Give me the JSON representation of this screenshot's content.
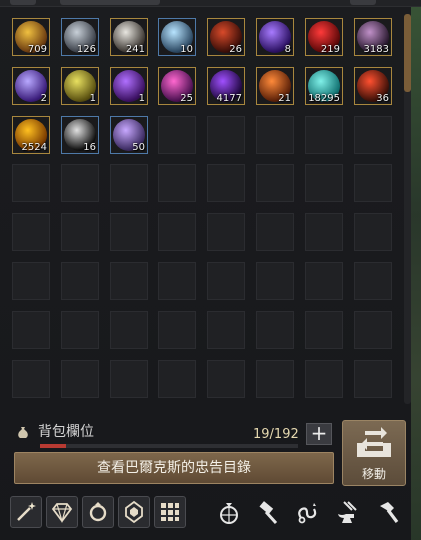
{
  "inventory": {
    "items": [
      {
        "count": "709",
        "c1": "#f0c040",
        "c2": "#6a3a10"
      },
      {
        "count": "126",
        "c1": "#c8d0d8",
        "c2": "#3a3f48"
      },
      {
        "count": "241",
        "c1": "#e8e6e0",
        "c2": "#3a3530"
      },
      {
        "count": "10",
        "c1": "#b8e4ff",
        "c2": "#2a4660"
      },
      {
        "count": "26",
        "c1": "#d84a2a",
        "c2": "#3a0e08"
      },
      {
        "count": "8",
        "c1": "#a87bff",
        "c2": "#2a1060"
      },
      {
        "count": "219",
        "c1": "#ff3a3a",
        "c2": "#5a0808"
      },
      {
        "count": "3183",
        "c1": "#c090c8",
        "c2": "#2a1a30"
      },
      {
        "count": "2",
        "c1": "#b8a8ff",
        "c2": "#3a1c7a"
      },
      {
        "count": "1",
        "c1": "#e8e060",
        "c2": "#5a5010"
      },
      {
        "count": "1",
        "c1": "#b070ff",
        "c2": "#3a1060"
      },
      {
        "count": "25",
        "c1": "#ff68d0",
        "c2": "#4a1050"
      },
      {
        "count": "4177",
        "c1": "#a050ff",
        "c2": "#200840"
      },
      {
        "count": "21",
        "c1": "#ff8a3a",
        "c2": "#5a2008"
      },
      {
        "count": "18295",
        "c1": "#80f0e8",
        "c2": "#107070"
      },
      {
        "count": "36",
        "c1": "#ff5030",
        "c2": "#3a1008"
      },
      {
        "count": "2524",
        "c1": "#ffc020",
        "c2": "#7a3a00"
      },
      {
        "count": "16",
        "c1": "#e0e0e0",
        "c2": "#101010"
      },
      {
        "count": "50",
        "c1": "#c8a8ff",
        "c2": "#3a2a60"
      }
    ]
  },
  "bag": {
    "label": "背包欄位",
    "capacity": "19/192",
    "fill_fraction": 0.099
  },
  "buttons": {
    "plus": "+",
    "move": "移動",
    "main": "查看巴爾克斯的忠告目錄"
  },
  "toolbar": {
    "left": [
      "wand-icon",
      "gem-icon",
      "ring-icon",
      "crystal-icon",
      "grid-icon"
    ],
    "right": [
      "orb-icon",
      "hammer-icon",
      "swirl-icon",
      "anvil-icon",
      "smith-hammer-icon"
    ]
  }
}
